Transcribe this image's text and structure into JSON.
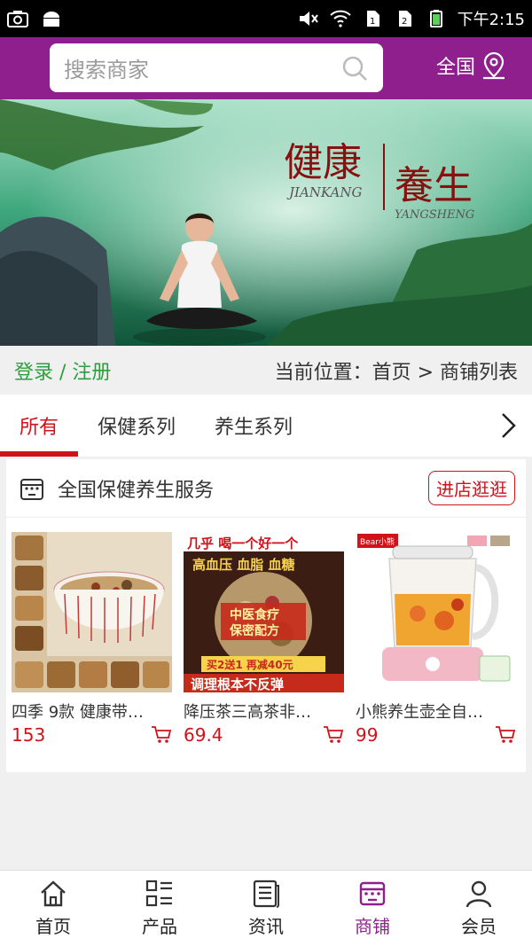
{
  "status_bar": {
    "time": "下午2:15",
    "icons": [
      "camera-icon",
      "android-icon",
      "mute-icon",
      "wifi-icon",
      "sim1-icon",
      "sim2-icon",
      "battery-icon"
    ]
  },
  "header": {
    "search_placeholder": "搜索商家",
    "region_label": "全国"
  },
  "banner": {
    "title_line1": "健康",
    "title_line2": "養生",
    "pinyin1": "JIANKANG",
    "pinyin2": "YANGSHENG"
  },
  "breadcrumb": {
    "login_label": "登录 / 注册",
    "location": "当前位置：首页 > 商铺列表"
  },
  "tabs": [
    {
      "label": "所有",
      "active": true
    },
    {
      "label": "保健系列",
      "active": false
    },
    {
      "label": "养生系列",
      "active": false
    }
  ],
  "shop": {
    "name": "全国保健养生服务",
    "visit_label": "进店逛逛",
    "products": [
      {
        "name": "四季 9款 健康带…",
        "price": "153"
      },
      {
        "name": "降压茶三高茶非…",
        "price": "69.4"
      },
      {
        "name": "小熊养生壶全自…",
        "price": "99"
      }
    ],
    "product2_text": {
      "line1": "几乎 喝一个好一个",
      "line2": "高血压 血脂 血糖",
      "line3": "中医食疗",
      "line4": "保密配方",
      "line5": "买2送1 再减40元",
      "line6": "调理根本不反弹"
    },
    "product3_brand": "Bear小熊"
  },
  "bottom_nav": [
    {
      "label": "首页",
      "icon": "home-icon",
      "active": false
    },
    {
      "label": "产品",
      "icon": "grid-list-icon",
      "active": false
    },
    {
      "label": "资讯",
      "icon": "news-icon",
      "active": false
    },
    {
      "label": "商铺",
      "icon": "shop-icon",
      "active": true
    },
    {
      "label": "会员",
      "icon": "user-icon",
      "active": false
    }
  ],
  "colors": {
    "brand": "#8e1f8c",
    "accent_red": "#d0121a",
    "login_green": "#2e9e3e"
  }
}
